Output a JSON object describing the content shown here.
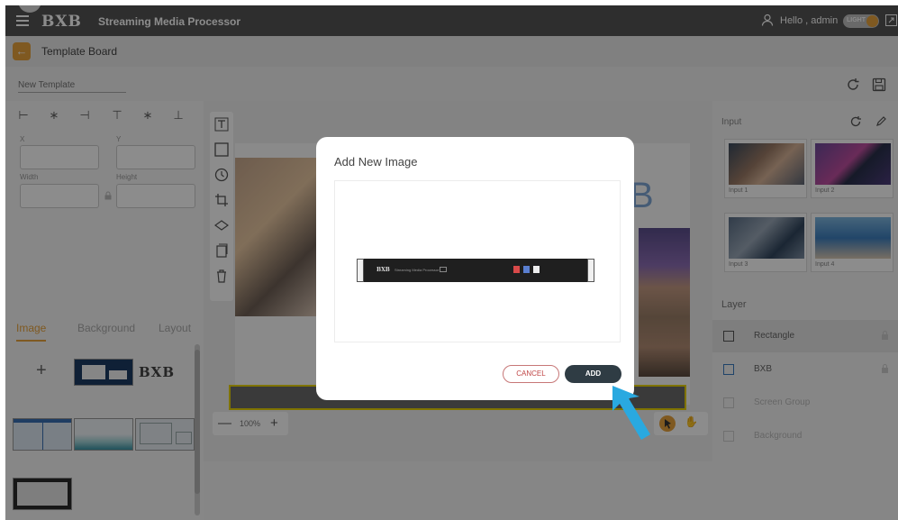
{
  "app": {
    "logo": "BXB",
    "title": "Streaming Media Processor",
    "greeting": "Hello , admin",
    "theme_label": "LIGHT"
  },
  "breadcrumb": {
    "title": "Template Board"
  },
  "template": {
    "name_placeholder": "New Template"
  },
  "properties": {
    "x_label": "X",
    "y_label": "Y",
    "width_label": "Width",
    "height_label": "Height"
  },
  "left_tabs": [
    "Image",
    "Background",
    "Layout"
  ],
  "image_tab": {
    "add_symbol": "+",
    "logo_text": "BXB"
  },
  "zoom": {
    "minus": "—",
    "value": "100%",
    "plus": "+"
  },
  "input_panel": {
    "title": "Input",
    "inputs": [
      {
        "label": "Input 1"
      },
      {
        "label": "Input 2"
      },
      {
        "label": "Input 3"
      },
      {
        "label": "Input 4"
      }
    ]
  },
  "layer_panel": {
    "title": "Layer",
    "layers": [
      {
        "name": "Rectangle"
      },
      {
        "name": "BXB"
      },
      {
        "name": "Screen Group"
      },
      {
        "name": "Background"
      }
    ]
  },
  "modal": {
    "title": "Add New Image",
    "cancel_label": "CANCEL",
    "add_label": "ADD",
    "device_brand": "BXB",
    "device_model": "Streaming Media Processor"
  },
  "colors": {
    "accent": "#e8a33c",
    "topbar": "#555555",
    "add_button": "#2f3c44",
    "cancel_text": "#c04545",
    "arrow": "#29a9e0",
    "canvas_border": "#e8d200"
  }
}
